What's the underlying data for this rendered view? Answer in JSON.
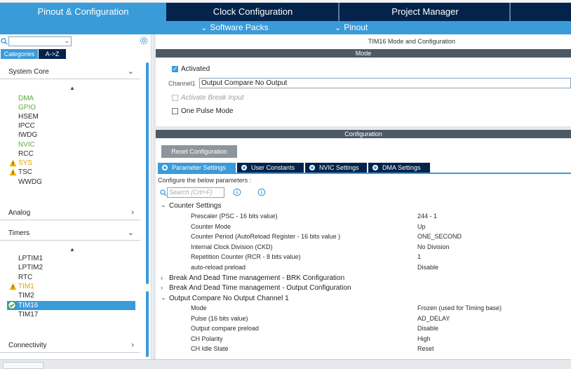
{
  "main_tabs": [
    "Pinout & Configuration",
    "Clock Configuration",
    "Project Manager"
  ],
  "sub_menu": [
    "Software Packs",
    "Pinout"
  ],
  "left": {
    "category_tabs": [
      "Categories",
      "A->Z"
    ],
    "sections": {
      "system_core": "System Core",
      "analog": "Analog",
      "timers": "Timers",
      "connectivity": "Connectivity"
    },
    "system_core_items": [
      "DMA",
      "GPIO",
      "HSEM",
      "IPCC",
      "IWDG",
      "NVIC",
      "RCC",
      "SYS",
      "TSC",
      "WWDG"
    ],
    "timer_items": [
      "LPTIM1",
      "LPTIM2",
      "RTC",
      "TIM1",
      "TIM2",
      "TIM16",
      "TIM17"
    ],
    "selected_timer": "TIM16"
  },
  "right": {
    "title": "TIM16 Mode and Configuration",
    "mode_header": "Mode",
    "activated_label": "Activated",
    "channel1_label": "Channel1",
    "channel1_value": "Output Compare No Output",
    "activate_break_label": "Activate Break Input",
    "one_pulse_label": "One Pulse Mode",
    "config_header": "Configuration",
    "reset_button": "Reset Configuration",
    "param_tabs": [
      "Parameter Settings",
      "User Constants",
      "NVIC Settings",
      "DMA Settings"
    ],
    "configure_hint": "Configure the below parameters :",
    "search_placeholder": "Search (Crtl+F)",
    "tree": {
      "counter_settings": "Counter Settings",
      "counter_rows": [
        {
          "name": "Prescaler (PSC - 16 bits value)",
          "value": "244 - 1"
        },
        {
          "name": "Counter Mode",
          "value": "Up"
        },
        {
          "name": "Counter Period (AutoReload Register - 16 bits value )",
          "value": "ONE_SECOND"
        },
        {
          "name": "Internal Clock Division (CKD)",
          "value": "No Division"
        },
        {
          "name": "Repetition Counter (RCR - 8 bits value)",
          "value": "1"
        },
        {
          "name": "auto-reload preload",
          "value": "Disable"
        }
      ],
      "break_brk": "Break And Dead Time management - BRK Configuration",
      "break_output": "Break And Dead Time management - Output Configuration",
      "oc_channel": "Output Compare No Output Channel 1",
      "oc_rows": [
        {
          "name": "Mode",
          "value": "Frozen (used for Timing base)"
        },
        {
          "name": "Pulse (16 bits value)",
          "value": "AD_DELAY"
        },
        {
          "name": "Output compare preload",
          "value": "Disable"
        },
        {
          "name": "CH Polarity",
          "value": "High"
        },
        {
          "name": "CH Idle State",
          "value": "Reset"
        }
      ]
    }
  },
  "colors": {
    "accent": "#3a9bd9",
    "navy": "#03234b",
    "green": "#5cad3b",
    "warning": "#f2b705"
  }
}
